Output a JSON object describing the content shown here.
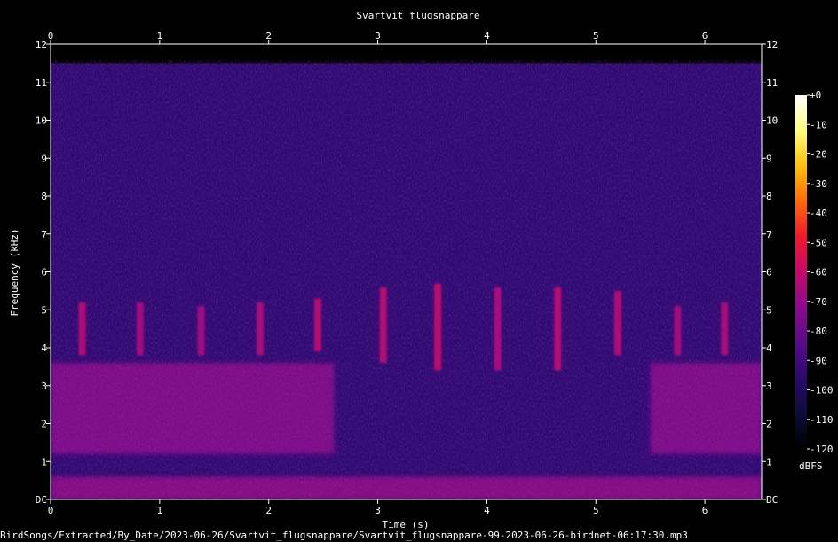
{
  "chart_data": {
    "type": "heatmap",
    "title": "Svartvit flugsnappare",
    "xlabel": "Time (s)",
    "ylabel": "Frequency (kHz)",
    "filename": "BirdSongs/Extracted/By_Date/2023-06-26/Svartvit_flugsnappare/Svartvit_flugsnappare-99-2023-06-26-birdnet-06:17:30.mp3",
    "xlim": [
      0,
      6.52
    ],
    "ylim": [
      0,
      12
    ],
    "x_ticks": [
      {
        "value": 0,
        "label": "0"
      },
      {
        "value": 1,
        "label": "1"
      },
      {
        "value": 2,
        "label": "2"
      },
      {
        "value": 3,
        "label": "3"
      },
      {
        "value": 4,
        "label": "4"
      },
      {
        "value": 5,
        "label": "5"
      },
      {
        "value": 6,
        "label": "6"
      }
    ],
    "y_ticks": [
      {
        "value": 0,
        "label": "DC"
      },
      {
        "value": 1,
        "label": "1"
      },
      {
        "value": 2,
        "label": "2"
      },
      {
        "value": 3,
        "label": "3"
      },
      {
        "value": 4,
        "label": "4"
      },
      {
        "value": 5,
        "label": "5"
      },
      {
        "value": 6,
        "label": "6"
      },
      {
        "value": 7,
        "label": "7"
      },
      {
        "value": 8,
        "label": "8"
      },
      {
        "value": 9,
        "label": "9"
      },
      {
        "value": 10,
        "label": "10"
      },
      {
        "value": 11,
        "label": "11"
      },
      {
        "value": 12,
        "label": "12"
      }
    ],
    "colorbar": {
      "unit": "dBFS",
      "range": [
        -120,
        0
      ],
      "ticks": [
        {
          "value": 0,
          "label": "+0"
        },
        {
          "value": -10,
          "label": "-10"
        },
        {
          "value": -20,
          "label": "-20"
        },
        {
          "value": -30,
          "label": "-30"
        },
        {
          "value": -40,
          "label": "-40"
        },
        {
          "value": -50,
          "label": "-50"
        },
        {
          "value": -60,
          "label": "-60"
        },
        {
          "value": -70,
          "label": "-70"
        },
        {
          "value": -80,
          "label": "-80"
        },
        {
          "value": -90,
          "label": "-90"
        },
        {
          "value": -100,
          "label": "-100"
        },
        {
          "value": -110,
          "label": "-110"
        },
        {
          "value": -120,
          "label": "-120"
        }
      ],
      "colors": [
        "#000000",
        "#0c0c3a",
        "#2a0a6e",
        "#5a0a8a",
        "#8c0a8c",
        "#c40a6a",
        "#ee1a2a",
        "#ff6a0a",
        "#ffc010",
        "#ffff80",
        "#ffffff"
      ]
    },
    "energy_bands": [
      {
        "name": "broadband noise",
        "t": [
          0,
          6.52
        ],
        "f": [
          0,
          11.5
        ],
        "db": -95
      },
      {
        "name": "low-frequency background",
        "t": [
          0,
          2.6
        ],
        "f": [
          1.2,
          3.6
        ],
        "db": -72
      },
      {
        "name": "low-frequency background",
        "t": [
          5.5,
          6.52
        ],
        "f": [
          1.2,
          3.6
        ],
        "db": -72
      },
      {
        "name": "ground hum",
        "t": [
          0,
          6.52
        ],
        "f": [
          0,
          0.6
        ],
        "db": -70
      }
    ],
    "song_elements": [
      {
        "t": 0.29,
        "f": [
          3.8,
          5.2
        ],
        "db": -65
      },
      {
        "t": 0.82,
        "f": [
          3.8,
          5.2
        ],
        "db": -68
      },
      {
        "t": 1.38,
        "f": [
          3.8,
          5.1
        ],
        "db": -68
      },
      {
        "t": 1.92,
        "f": [
          3.8,
          5.2
        ],
        "db": -66
      },
      {
        "t": 2.45,
        "f": [
          3.9,
          5.3
        ],
        "db": -64
      },
      {
        "t": 3.05,
        "f": [
          3.6,
          5.6
        ],
        "db": -63
      },
      {
        "t": 3.55,
        "f": [
          3.4,
          5.7
        ],
        "db": -62
      },
      {
        "t": 4.1,
        "f": [
          3.4,
          5.6
        ],
        "db": -66
      },
      {
        "t": 4.65,
        "f": [
          3.4,
          5.6
        ],
        "db": -63
      },
      {
        "t": 5.2,
        "f": [
          3.8,
          5.5
        ],
        "db": -65
      },
      {
        "t": 5.75,
        "f": [
          3.8,
          5.1
        ],
        "db": -67
      },
      {
        "t": 6.18,
        "f": [
          3.8,
          5.2
        ],
        "db": -66
      }
    ]
  }
}
